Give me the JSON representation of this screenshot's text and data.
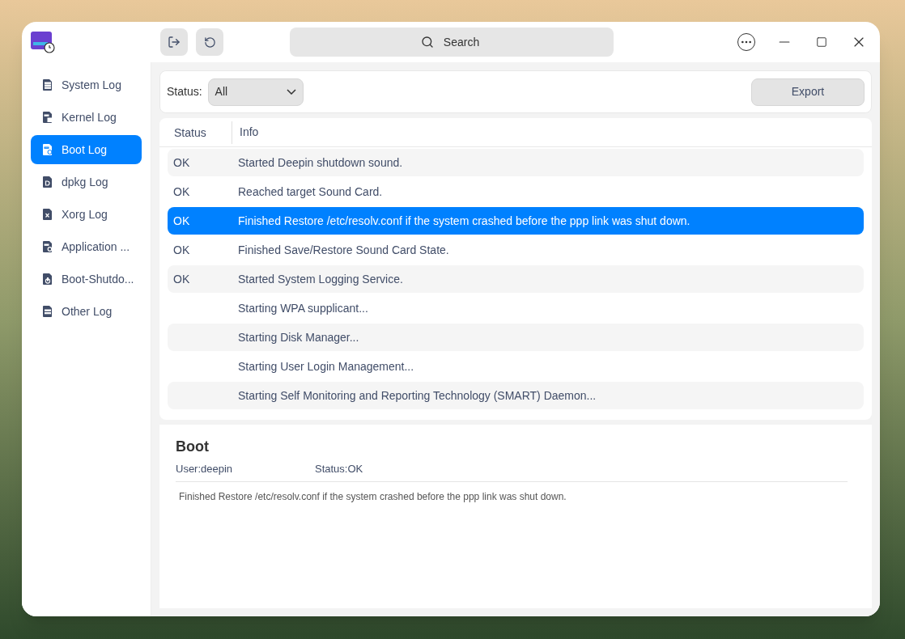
{
  "search": {
    "placeholder": "Search"
  },
  "sidebar": {
    "items": [
      {
        "label": "System Log",
        "selected": false
      },
      {
        "label": "Kernel Log",
        "selected": false
      },
      {
        "label": "Boot Log",
        "selected": true
      },
      {
        "label": "dpkg Log",
        "selected": false
      },
      {
        "label": "Xorg Log",
        "selected": false
      },
      {
        "label": "Application ...",
        "selected": false
      },
      {
        "label": "Boot-Shutdo...",
        "selected": false
      },
      {
        "label": "Other Log",
        "selected": false
      }
    ]
  },
  "filter": {
    "label": "Status:",
    "value": "All",
    "export": "Export"
  },
  "table": {
    "columns": [
      "Status",
      "Info"
    ],
    "rows": [
      {
        "status": "OK",
        "info": "Started Deepin shutdown sound.",
        "selected": false
      },
      {
        "status": "OK",
        "info": "Reached target Sound Card.",
        "selected": false
      },
      {
        "status": "OK",
        "info": "Finished Restore /etc/resolv.conf if the system crashed before the ppp link was shut down.",
        "selected": true
      },
      {
        "status": "OK",
        "info": "Finished Save/Restore Sound Card State.",
        "selected": false
      },
      {
        "status": "OK",
        "info": "Started System Logging Service.",
        "selected": false
      },
      {
        "info": "Starting WPA supplicant...",
        "selected": false
      },
      {
        "info": "Starting Disk Manager...",
        "selected": false
      },
      {
        "info": "Starting User Login Management...",
        "selected": false
      },
      {
        "info": "Starting Self Monitoring and Reporting Technology (SMART) Daemon...",
        "selected": false
      }
    ]
  },
  "detail": {
    "title": "Boot",
    "user": "User:deepin",
    "status": "Status:OK",
    "message": "Finished Restore /etc/resolv.conf if the system crashed before the ppp link was shut down."
  }
}
